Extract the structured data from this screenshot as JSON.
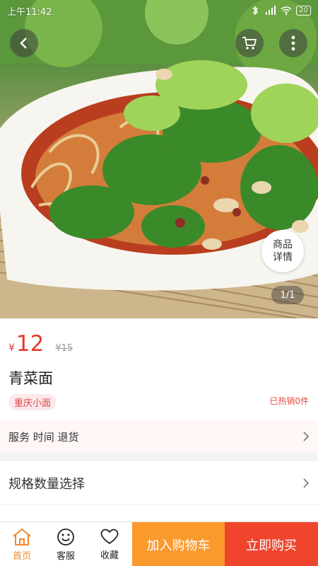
{
  "status": {
    "time": "上午11:42",
    "battery": "20"
  },
  "product": {
    "currency": "¥",
    "price": "12",
    "original_price": "¥15",
    "name": "青菜面",
    "tag": "重庆小面",
    "sold": "已热销0件",
    "detail_label_1": "商品",
    "detail_label_2": "详情",
    "pager": "1/1"
  },
  "rows": {
    "service": "服务 时间 退货",
    "spec": "规格数量选择"
  },
  "tabbar": {
    "home": "首页",
    "service": "客服",
    "favorite": "收藏",
    "add_to_cart": "加入购物车",
    "buy_now": "立即购买"
  },
  "colors": {
    "accent": "#e63a2e",
    "cart_button": "#fa9a2d",
    "buy_button": "#f0452d",
    "active_tab": "#ef8a2b"
  },
  "icons": [
    "back-icon",
    "cart-icon",
    "more-icon",
    "chevron-right-icon",
    "home-icon",
    "smile-icon",
    "heart-icon"
  ]
}
